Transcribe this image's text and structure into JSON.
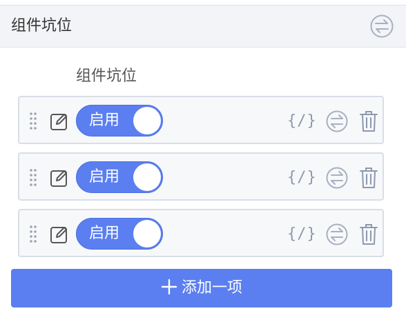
{
  "header": {
    "title": "组件坑位"
  },
  "sub_label": "组件坑位",
  "items": [
    {
      "toggle_label": "启用",
      "code_label": "{/}"
    },
    {
      "toggle_label": "启用",
      "code_label": "{/}"
    },
    {
      "toggle_label": "启用",
      "code_label": "{/}"
    }
  ],
  "add_button": {
    "label": "添加一项"
  },
  "colors": {
    "accent": "#5b7ff0",
    "icon_gray": "#8c98ad",
    "header_bg": "#f3f4f7",
    "item_bg": "#f7f8fa"
  }
}
